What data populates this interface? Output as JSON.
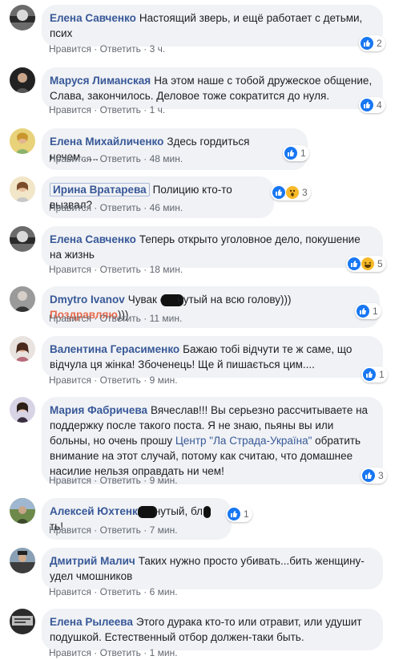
{
  "actions": {
    "like": "Нравится",
    "reply": "Ответить",
    "sep": "·"
  },
  "comments": [
    {
      "name": "Елена Савченко",
      "text": "Настоящий зверь, и ещё работает с детьми, псих",
      "time": "3 ч.",
      "reactions": {
        "count": "2",
        "types": [
          "like"
        ]
      }
    },
    {
      "name": "Маруся Лиманская",
      "text": "На этом наше с тобой дружеское общение, Слава, закончилось. Деловое тоже сократится до нуля.",
      "time": "1 ч.",
      "reactions": {
        "count": "4",
        "types": [
          "like"
        ]
      }
    },
    {
      "name": "Елена Михайличенко",
      "text": "Здесь гордиться нечем......",
      "time": "48 мин.",
      "reactions": {
        "count": "1",
        "types": [
          "like"
        ]
      }
    },
    {
      "name": "Ирина Вратарева",
      "text": "Полицию кто-то вызвал?",
      "time": "46 мин.",
      "reactions": {
        "count": "3",
        "types": [
          "like",
          "wow"
        ]
      }
    },
    {
      "name": "Елена Савченко",
      "text": "Теперь открыто уголовное дело, покушение на жизнь",
      "time": "18 мин.",
      "reactions": {
        "count": "5",
        "types": [
          "like",
          "haha"
        ]
      }
    },
    {
      "name": "Dmytro Ivanov",
      "text_before": "Чувак е",
      "text_after": "нутый на всю голову)))",
      "tag": "Поздравляю",
      "text_end": ")))",
      "time": "11 мин.",
      "reactions": {
        "count": "1",
        "types": [
          "like"
        ]
      }
    },
    {
      "name": "Валентина Герасименко",
      "text": "Бажаю тобі відчути те ж саме, що відчула ця жінка! Збоченець! Ще й пишається цим....",
      "time": "9 мин.",
      "reactions": {
        "count": "1",
        "types": [
          "like"
        ]
      }
    },
    {
      "name": "Мария Фабричева",
      "text_before": "Вячеслав!!! Вы серьезно рассчитываете на поддержку после такого поста. Я не знаю, пьяны вы или больны, но очень прошу ",
      "link": "Центр \"Ла Страда-Україна\"",
      "text_after": " обратить внимание на этот случай, потому как считаю, что домашнее насилие нельзя оправдать ни чем!",
      "time": "9 мин.",
      "reactions": {
        "count": "3",
        "types": [
          "like"
        ]
      }
    },
    {
      "name": "Алексей Юхтенко",
      "text_before": "нутый, бл",
      "text_after": "ть!",
      "time": "7 мин.",
      "reactions": {
        "count": "1",
        "types": [
          "like"
        ]
      }
    },
    {
      "name": "Дмитрий Малич",
      "text": "Таких нужно просто убивать...бить женщину-удел чмошников",
      "time": "6 мин."
    },
    {
      "name": "Елена Рылеева",
      "text": "Этого дурака кто-то или отравит, или удушит подушкой. Естественный отбор должен-таки быть.",
      "time": "1 мин."
    }
  ]
}
